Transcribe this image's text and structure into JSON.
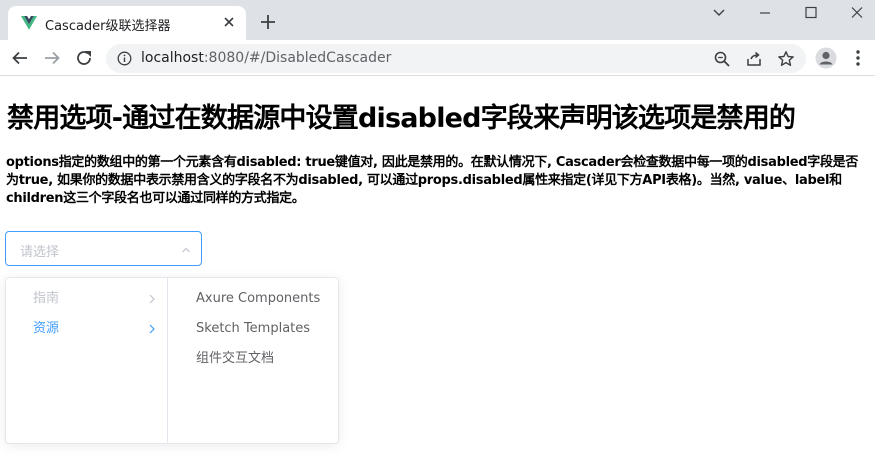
{
  "browser": {
    "tab_title": "Cascader级联选择器",
    "url_host": "localhost",
    "url_rest": ":8080/#/DisabledCascader"
  },
  "page": {
    "heading": "禁用选项-通过在数据源中设置disabled字段来声明该选项是禁用的",
    "description": "options指定的数组中的第一个元素含有disabled: true键值对, 因此是禁用的。在默认情况下, Cascader会检查数据中每一项的disabled字段是否为true, 如果你的数据中表示禁用含义的字段名不为disabled, 可以通过props.disabled属性来指定(详见下方API表格)。当然, value、label和children这三个字段名也可以通过同样的方式指定。"
  },
  "cascader": {
    "placeholder": "请选择",
    "level1": [
      {
        "label": "指南",
        "state": "disabled"
      },
      {
        "label": "资源",
        "state": "active"
      }
    ],
    "level2": [
      {
        "label": "Axure Components"
      },
      {
        "label": "Sketch Templates"
      },
      {
        "label": "组件交互文档"
      }
    ]
  },
  "colors": {
    "accent": "#409eff",
    "disabled": "#c0c4cc",
    "text": "#606266",
    "tabstrip": "#dee1e6"
  },
  "icons": [
    "vue-logo-icon",
    "close-icon",
    "plus-icon",
    "minimize-icon",
    "maximize-icon",
    "window-close-icon",
    "chevron-down-icon",
    "back-arrow-icon",
    "forward-arrow-icon",
    "reload-icon",
    "info-icon",
    "zoom-icon",
    "share-icon",
    "star-icon",
    "profile-icon",
    "more-icon",
    "chevron-up-icon",
    "chevron-right-icon"
  ]
}
